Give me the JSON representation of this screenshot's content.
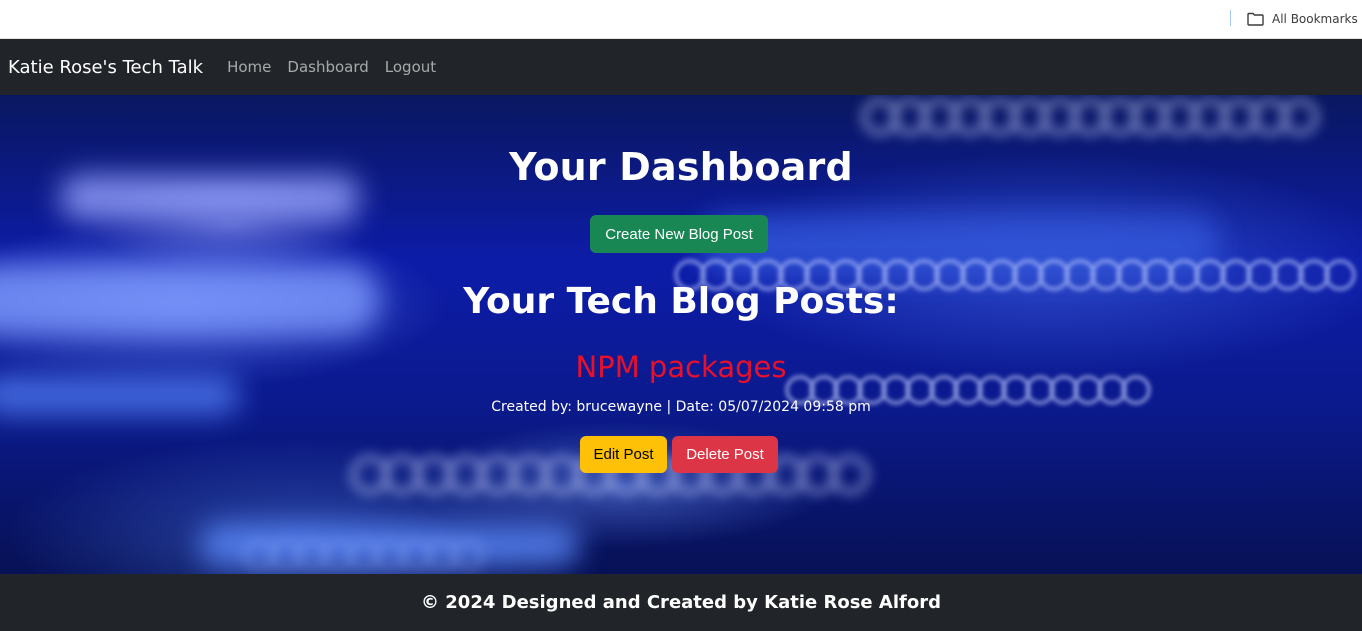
{
  "bookmarks_bar": {
    "all_bookmarks_label": "All Bookmarks",
    "icon": "folder-icon"
  },
  "navbar": {
    "brand": "Katie Rose's Tech Talk",
    "links": [
      "Home",
      "Dashboard",
      "Logout"
    ]
  },
  "dashboard": {
    "title": "Your Dashboard",
    "create_button_label": "Create New Blog Post",
    "posts_heading": "Your Tech Blog Posts:",
    "posts": [
      {
        "title": "NPM packages",
        "meta": "Created by: brucewayne | Date: 05/07/2024 09:58 pm",
        "edit_label": "Edit Post",
        "delete_label": "Delete Post"
      }
    ]
  },
  "footer": {
    "text": "© 2024 Designed and Created by Katie Rose Alford"
  },
  "colors": {
    "navbar_bg": "#212529",
    "create_button": "#198754",
    "edit_button": "#ffc107",
    "delete_button": "#dc3545",
    "post_title": "#e8102a"
  }
}
